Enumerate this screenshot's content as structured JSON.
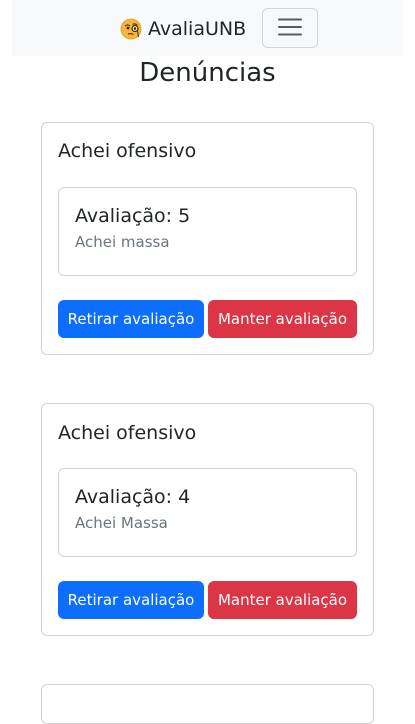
{
  "navbar": {
    "brand_emoji_icon": "face-with-monocle-icon",
    "brand_text": "AvaliaUNB",
    "toggler_icon": "hamburger-menu-icon"
  },
  "page": {
    "title": "Denúncias"
  },
  "reports": [
    {
      "reason": "Achei ofensivo",
      "rating_label": "Avaliação: 5",
      "comment": "Achei massa",
      "remove_label": "Retirar avaliação",
      "keep_label": "Manter avaliação"
    },
    {
      "reason": "Achei ofensivo",
      "rating_label": "Avaliação: 4",
      "comment": "Achei Massa",
      "remove_label": "Retirar avaliação",
      "keep_label": "Manter avaliação"
    }
  ],
  "colors": {
    "primary": "#0d6efd",
    "danger": "#dc3545",
    "navbar_bg": "#f8f9fa",
    "muted_text": "#6c757d"
  }
}
